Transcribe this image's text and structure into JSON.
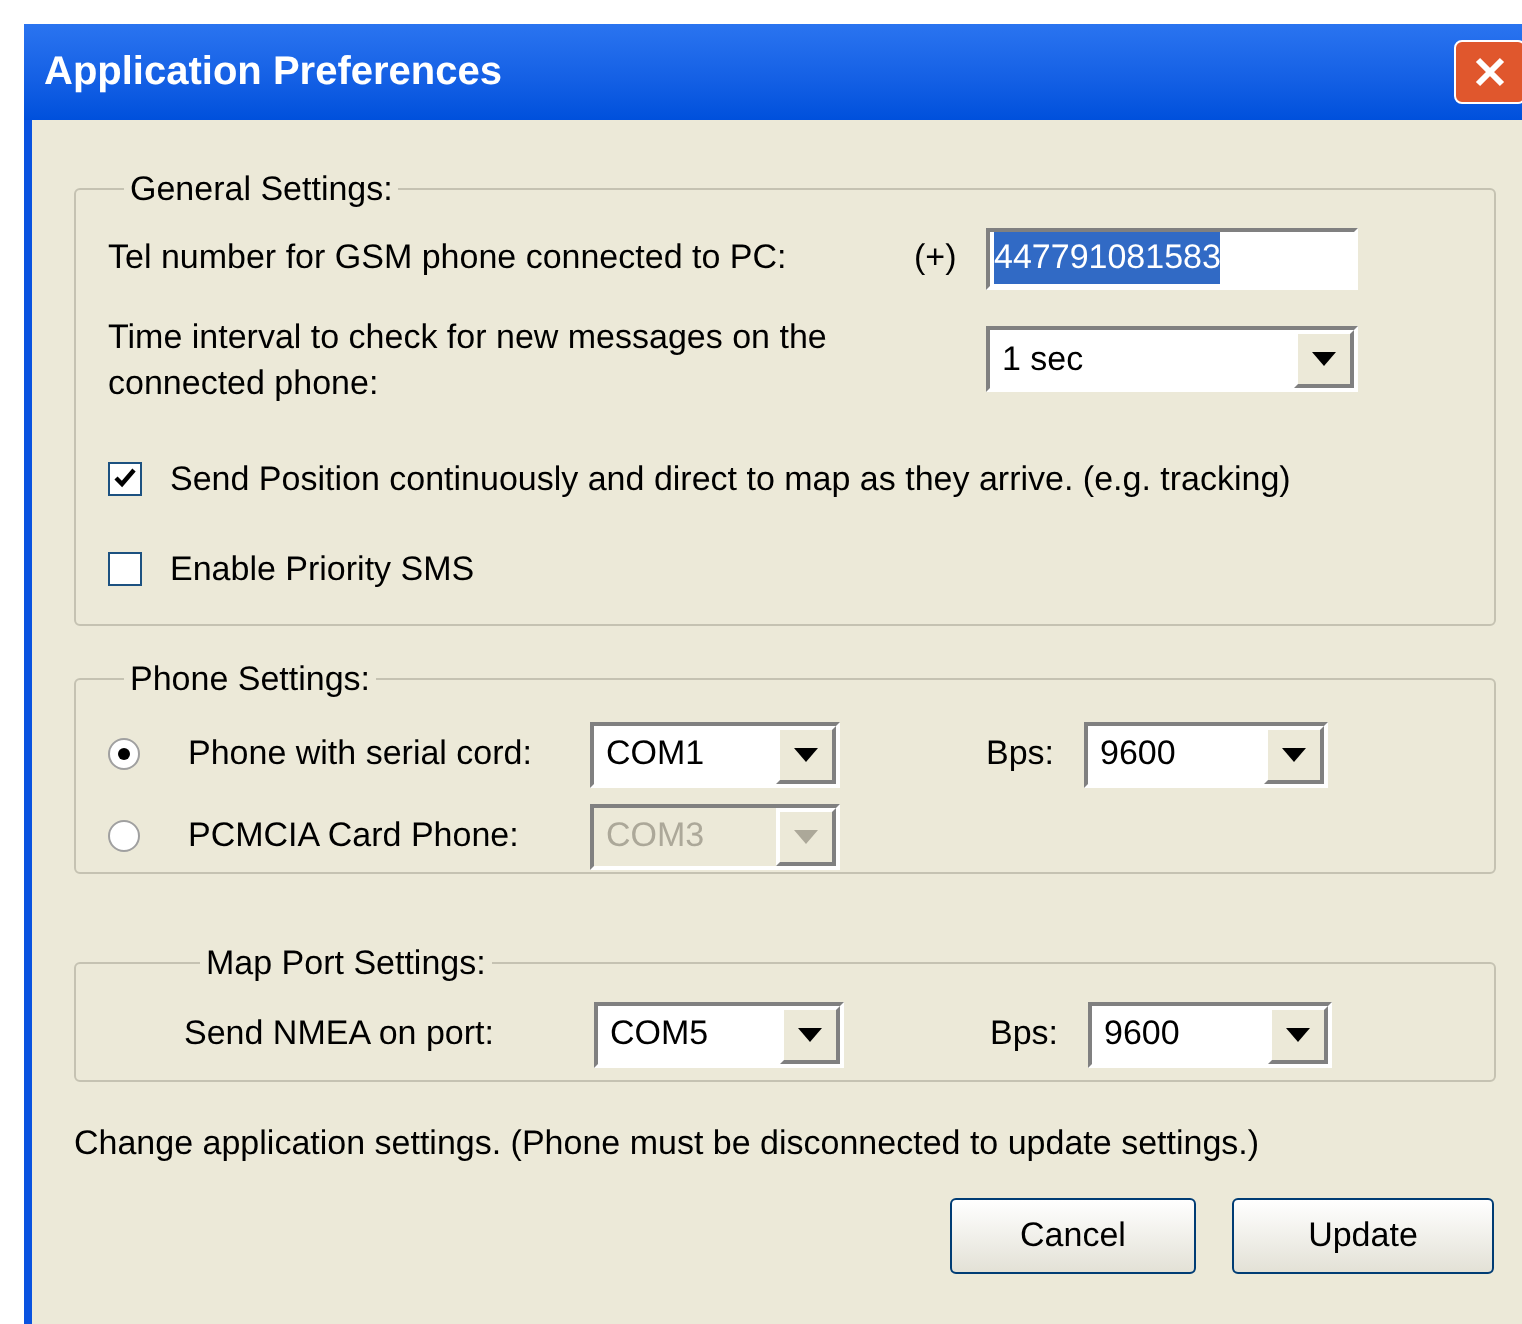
{
  "window": {
    "title": "Application Preferences"
  },
  "general_settings": {
    "title": "General Settings:",
    "phone_number": {
      "label": "Tel number for GSM phone connected to PC:",
      "prefix": "(+)",
      "value": "447791081583",
      "text_selected": true
    },
    "check_interval": {
      "label": "Time interval to check for new messages on the connected phone:",
      "value": "1 sec"
    },
    "checkboxes": [
      {
        "label": "Send Position continuously and direct to map as they arrive. (e.g. tracking)",
        "checked": true
      },
      {
        "label": "Enable Priority SMS",
        "checked": false
      }
    ]
  },
  "phone_settings": {
    "title": "Phone Settings:",
    "options": [
      {
        "label": "Phone with serial cord:",
        "selected": true,
        "port": "COM1",
        "disabled": false,
        "bps_label": "Bps:",
        "bps": "9600"
      },
      {
        "label": "PCMCIA Card Phone:",
        "selected": false,
        "port": "COM3",
        "disabled": true
      }
    ]
  },
  "map_port_settings": {
    "title": "Map Port Settings:",
    "label": "Send NMEA on port:",
    "port": "COM5",
    "bps_label": "Bps:",
    "bps": "9600"
  },
  "status_text": "Change application settings. (Phone must be disconnected to update settings.)",
  "buttons": [
    "Cancel",
    "Update"
  ]
}
